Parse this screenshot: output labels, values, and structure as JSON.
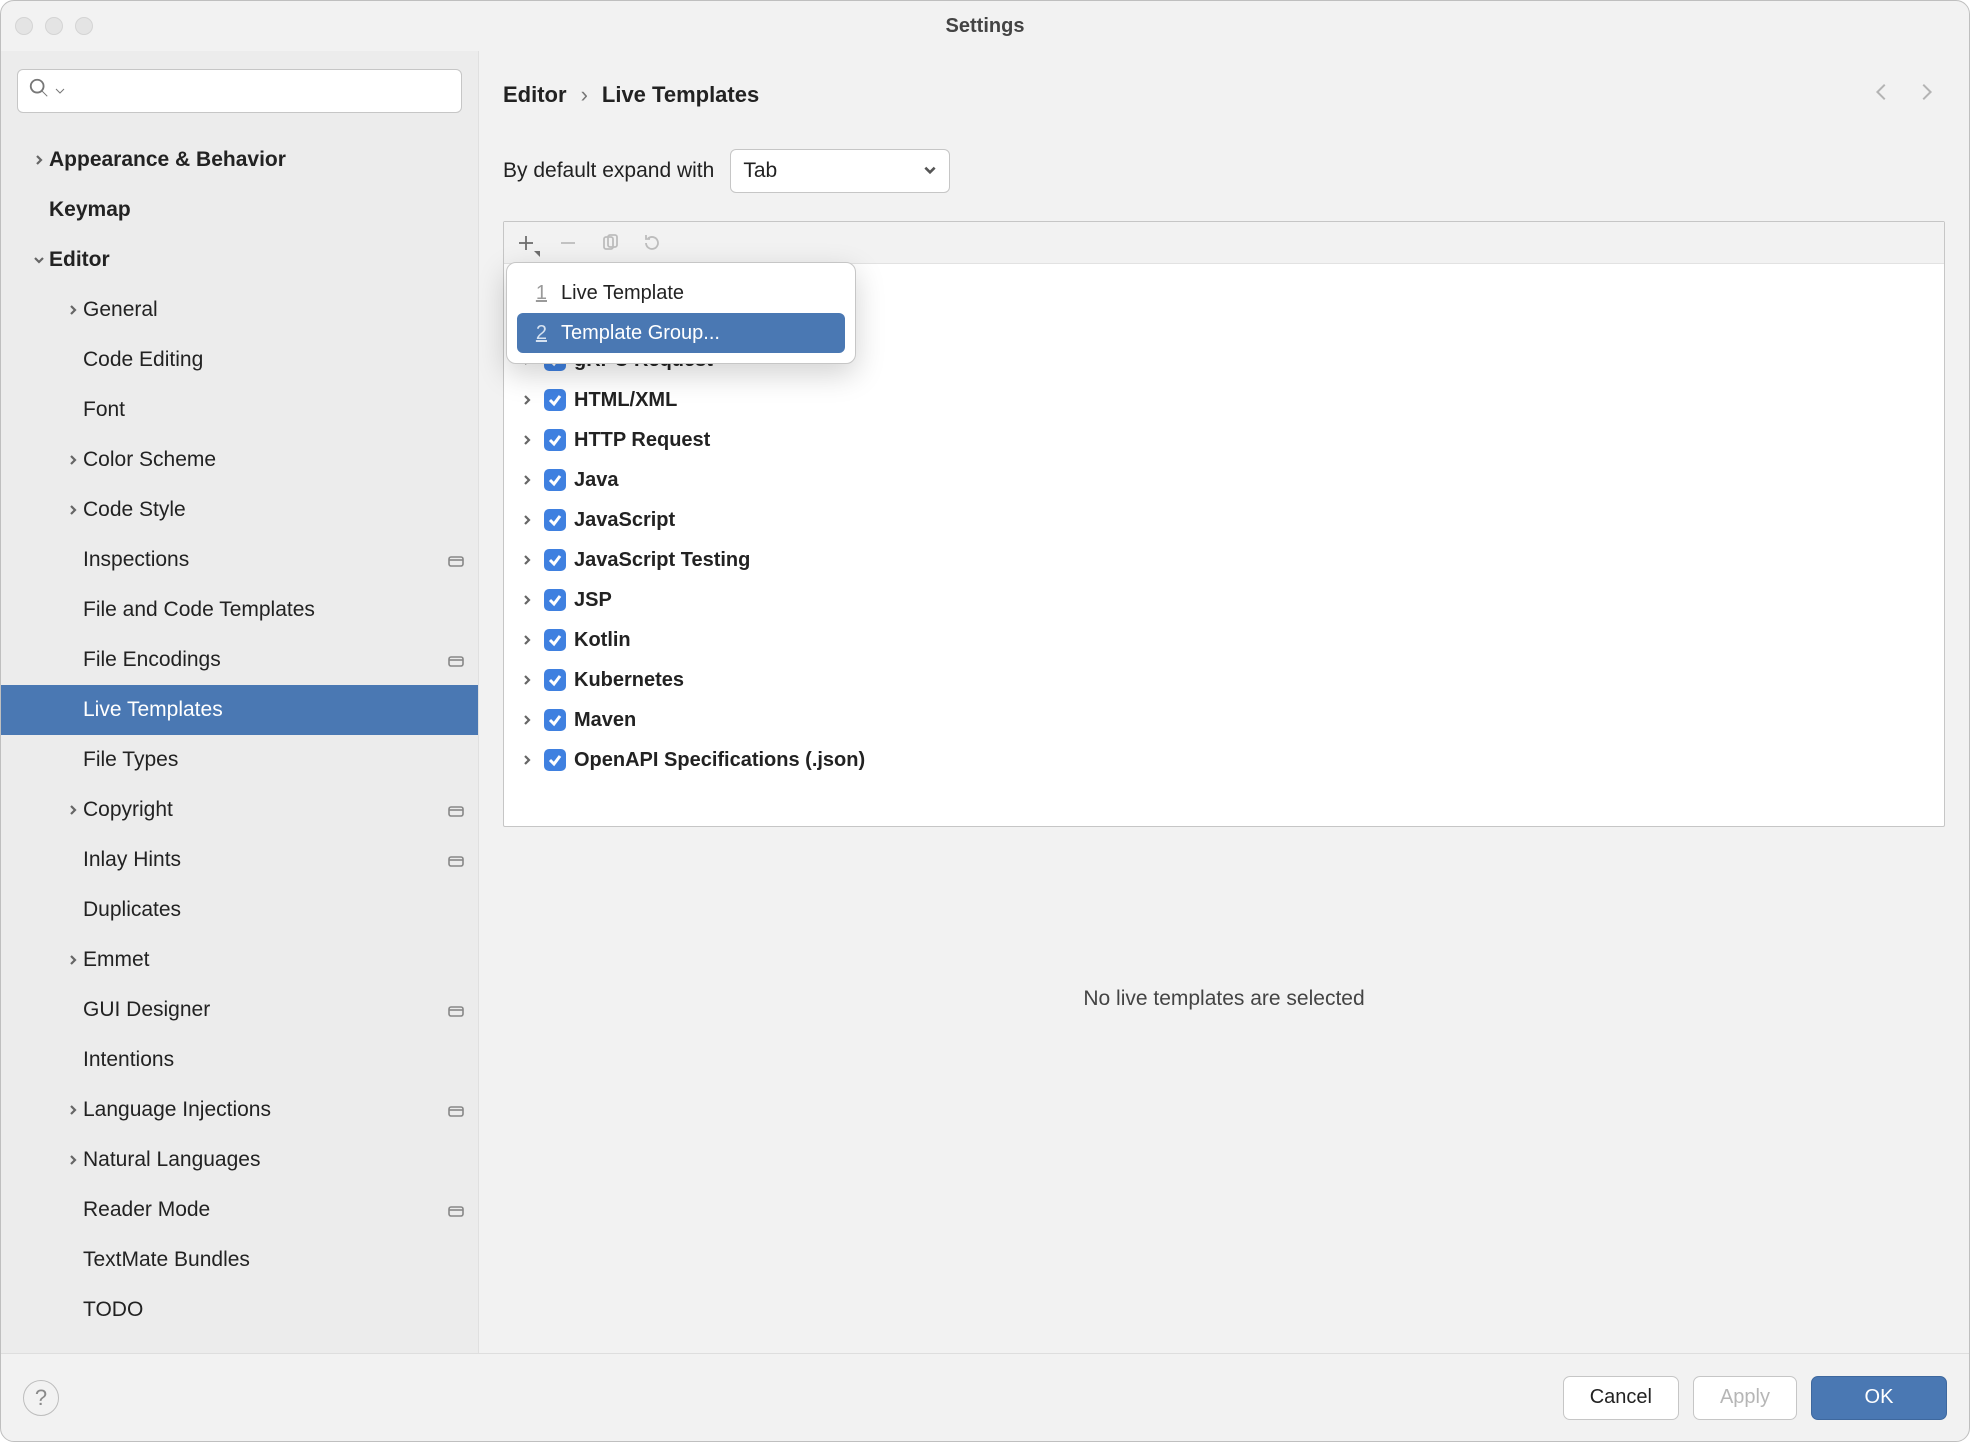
{
  "title": "Settings",
  "breadcrumb": {
    "root": "Editor",
    "current": "Live Templates"
  },
  "sidebar": {
    "items": [
      {
        "label": "Appearance & Behavior",
        "level": 0,
        "bold": true,
        "expand": "right",
        "badge": false
      },
      {
        "label": "Keymap",
        "level": 0,
        "bold": true,
        "expand": "none",
        "badge": false
      },
      {
        "label": "Editor",
        "level": 0,
        "bold": true,
        "expand": "down",
        "badge": false
      },
      {
        "label": "General",
        "level": 1,
        "bold": false,
        "expand": "right",
        "badge": false
      },
      {
        "label": "Code Editing",
        "level": 1,
        "bold": false,
        "expand": "none",
        "badge": false
      },
      {
        "label": "Font",
        "level": 1,
        "bold": false,
        "expand": "none",
        "badge": false
      },
      {
        "label": "Color Scheme",
        "level": 1,
        "bold": false,
        "expand": "right",
        "badge": false
      },
      {
        "label": "Code Style",
        "level": 1,
        "bold": false,
        "expand": "right",
        "badge": false
      },
      {
        "label": "Inspections",
        "level": 1,
        "bold": false,
        "expand": "none",
        "badge": true
      },
      {
        "label": "File and Code Templates",
        "level": 1,
        "bold": false,
        "expand": "none",
        "badge": false
      },
      {
        "label": "File Encodings",
        "level": 1,
        "bold": false,
        "expand": "none",
        "badge": true
      },
      {
        "label": "Live Templates",
        "level": 1,
        "bold": false,
        "expand": "none",
        "badge": false,
        "selected": true
      },
      {
        "label": "File Types",
        "level": 1,
        "bold": false,
        "expand": "none",
        "badge": false
      },
      {
        "label": "Copyright",
        "level": 1,
        "bold": false,
        "expand": "right",
        "badge": true
      },
      {
        "label": "Inlay Hints",
        "level": 1,
        "bold": false,
        "expand": "none",
        "badge": true
      },
      {
        "label": "Duplicates",
        "level": 1,
        "bold": false,
        "expand": "none",
        "badge": false
      },
      {
        "label": "Emmet",
        "level": 1,
        "bold": false,
        "expand": "right",
        "badge": false
      },
      {
        "label": "GUI Designer",
        "level": 1,
        "bold": false,
        "expand": "none",
        "badge": true
      },
      {
        "label": "Intentions",
        "level": 1,
        "bold": false,
        "expand": "none",
        "badge": false
      },
      {
        "label": "Language Injections",
        "level": 1,
        "bold": false,
        "expand": "right",
        "badge": true
      },
      {
        "label": "Natural Languages",
        "level": 1,
        "bold": false,
        "expand": "right",
        "badge": false
      },
      {
        "label": "Reader Mode",
        "level": 1,
        "bold": false,
        "expand": "none",
        "badge": true
      },
      {
        "label": "TextMate Bundles",
        "level": 1,
        "bold": false,
        "expand": "none",
        "badge": false
      },
      {
        "label": "TODO",
        "level": 1,
        "bold": false,
        "expand": "none",
        "badge": false
      }
    ]
  },
  "expand_row": {
    "label": "By default expand with",
    "selected": "Tab"
  },
  "popup": {
    "items": [
      {
        "num": "1",
        "label": "Live Template",
        "selected": false
      },
      {
        "num": "2",
        "label": "Template Group...",
        "selected": true
      }
    ]
  },
  "groups": [
    "gRPC Request",
    "HTML/XML",
    "HTTP Request",
    "Java",
    "JavaScript",
    "JavaScript Testing",
    "JSP",
    "Kotlin",
    "Kubernetes",
    "Maven",
    "OpenAPI Specifications (.json)"
  ],
  "empty_message": "No live templates are selected",
  "footer": {
    "cancel": "Cancel",
    "apply": "Apply",
    "ok": "OK"
  }
}
